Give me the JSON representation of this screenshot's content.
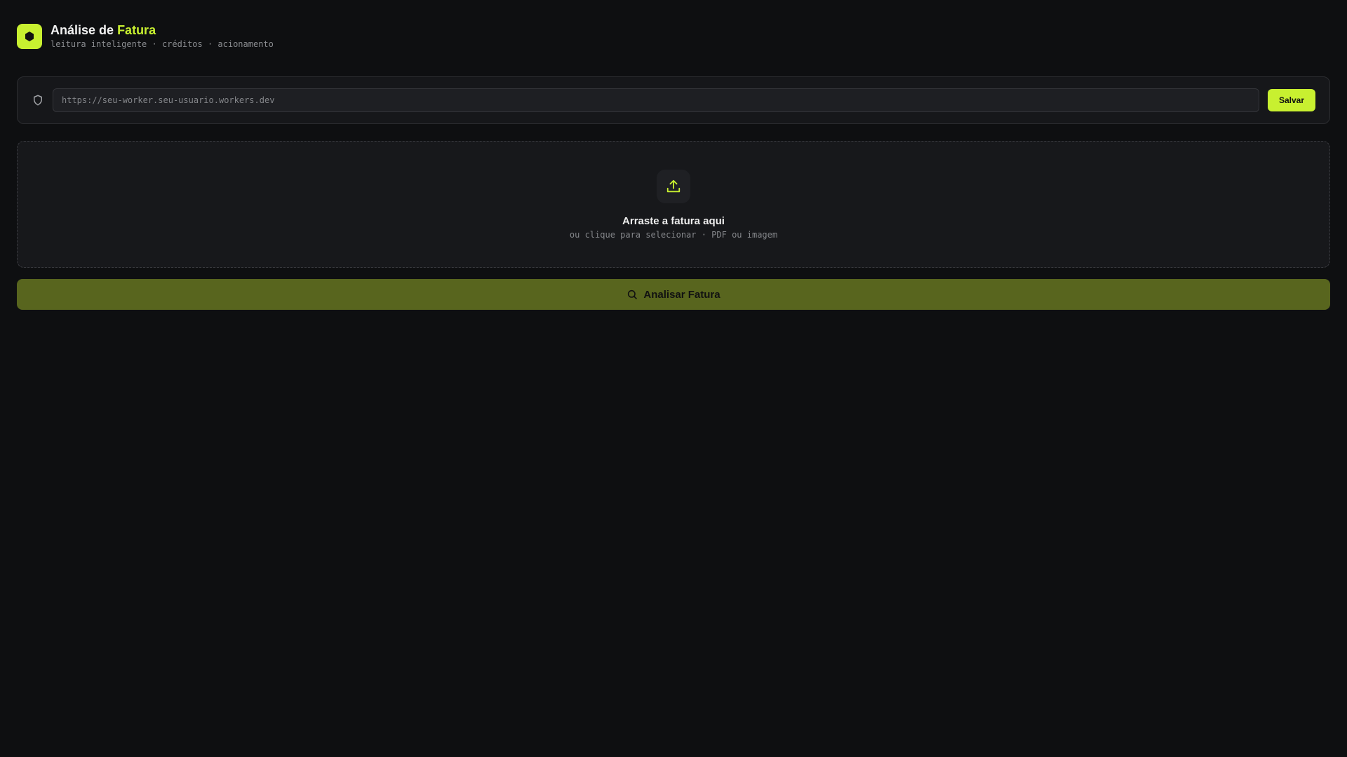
{
  "header": {
    "title_main": "Análise de",
    "title_accent": "Fatura",
    "subtitle": "leitura inteligente · créditos · acionamento"
  },
  "config": {
    "url_placeholder": "https://seu-worker.seu-usuario.workers.dev",
    "url_value": "",
    "save_label": "Salvar"
  },
  "dropzone": {
    "title": "Arraste a fatura aqui",
    "subtitle": "ou clique para selecionar · PDF ou imagem"
  },
  "analyze_label": "Analisar Fatura",
  "colors": {
    "accent": "#c8f030",
    "background": "#0e0f11",
    "analyze_button": "#58651e"
  }
}
